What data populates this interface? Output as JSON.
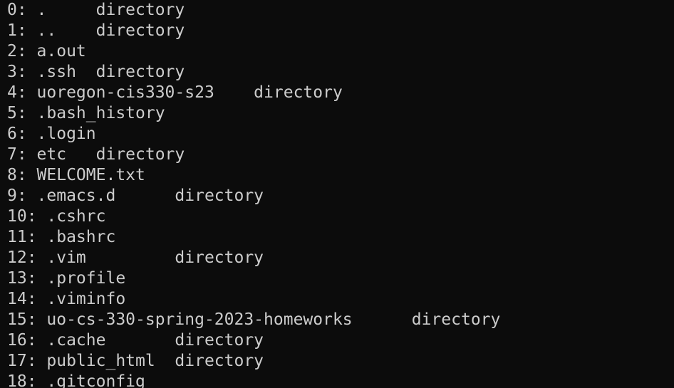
{
  "terminal": {
    "lines": [
      "0: .     directory",
      "1: ..    directory",
      "2: a.out",
      "3: .ssh  directory",
      "4: uoregon-cis330-s23    directory",
      "5: .bash_history",
      "6: .login",
      "7: etc   directory",
      "8: WELCOME.txt",
      "9: .emacs.d      directory",
      "10: .cshrc",
      "11: .bashrc",
      "12: .vim         directory",
      "13: .profile",
      "14: .viminfo",
      "15: uo-cs-330-spring-2023-homeworks      directory",
      "16: .cache       directory",
      "17: public_html  directory",
      "18: .gitconfig"
    ]
  },
  "colors": {
    "background": "#0c0c0c",
    "foreground": "#cccccc"
  }
}
